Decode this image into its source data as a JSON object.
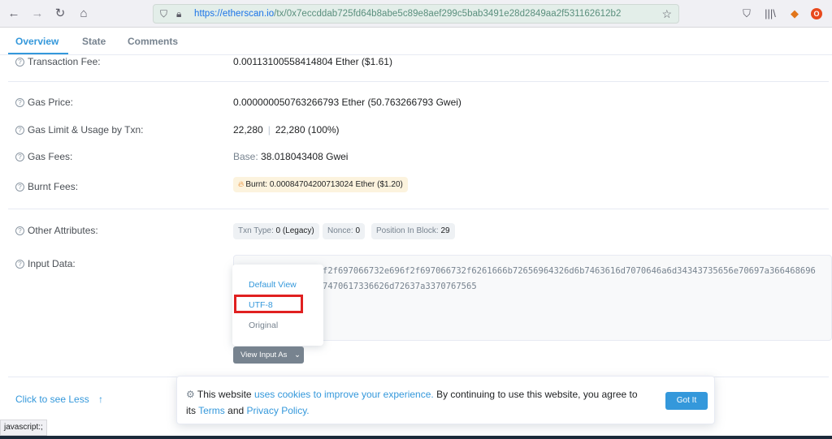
{
  "browser": {
    "url_host": "https://etherscan.io",
    "url_path": "/tx/0x7eccddab725fd64b8abe5c89e8aef299c5bab3491e28d2849aa2f531162612b2",
    "icons": [
      "back-arrow",
      "forward-arrow",
      "reload",
      "home",
      "shield",
      "lock",
      "star",
      "pocket",
      "library",
      "metamask",
      "adblock"
    ]
  },
  "tabs": [
    {
      "label": "Overview"
    },
    {
      "label": "State"
    },
    {
      "label": "Comments"
    }
  ],
  "rows": {
    "transaction_fee": {
      "label": "Transaction Fee:",
      "value": "0.00113100558414804 Ether ($1.61)"
    },
    "gas_price": {
      "label": "Gas Price:",
      "value": "0.000000050763266793 Ether (50.763266793 Gwei)"
    },
    "gas_limit": {
      "label": "Gas Limit & Usage by Txn:",
      "limit": "22,280",
      "sep": "|",
      "usage": "22,280 (100%)"
    },
    "gas_fees": {
      "label": "Gas Fees:",
      "base_label": "Base:",
      "base_value": "38.018043408 Gwei"
    },
    "burnt_fees": {
      "label": "Burnt Fees:",
      "badge_label": "Burnt:",
      "badge_value": "0.00084704200713024 Ether ($1.20)"
    },
    "other_attributes": {
      "label": "Other Attributes:",
      "chips": [
        {
          "key": "Txn Type:",
          "value": "0 (Legacy)"
        },
        {
          "key": "Nonce:",
          "value": "0"
        },
        {
          "key": "Position In Block:",
          "value": "29"
        }
      ]
    },
    "input_data": {
      "label": "Input Data:",
      "hex_line_1": "f2f697066732e696f2f697066732f6261666b72656964326d6b7463616d7070646a6d34343735656e70697a366468696",
      "hex_line_2": "7470617336626d72637a3370767565"
    }
  },
  "dropdown": {
    "items": [
      "Default View",
      "UTF-8",
      "Original"
    ]
  },
  "view_input_button": {
    "label": "View Input As",
    "caret": "⌄"
  },
  "click_to_see_less": {
    "label": "Click to see Less",
    "arrow": "↑"
  },
  "cookie_banner": {
    "prefix": "This website",
    "link1": "uses cookies to improve your experience.",
    "middle": "By continuing to use this website, you agree to its",
    "link2": "Terms",
    "and": "and",
    "link3": "Privacy Policy.",
    "button": "Got It"
  },
  "status_bar": {
    "text": "javascript:;"
  },
  "colors": {
    "accent": "#3498db",
    "highlight": "#e02020",
    "badge_bg": "#fcf3de"
  }
}
